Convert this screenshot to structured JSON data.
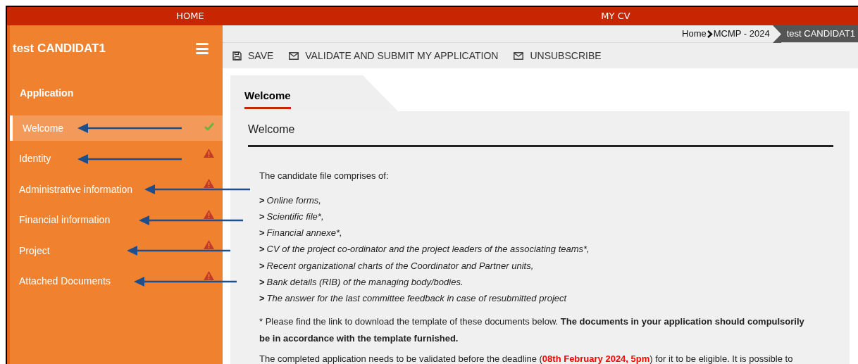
{
  "top_nav": [
    {
      "label": "HOME"
    },
    {
      "label": "MY CV"
    }
  ],
  "sidebar": {
    "user": "test CANDIDAT1",
    "section": "Application",
    "items": [
      {
        "label": "Welcome",
        "selected": true,
        "complete": true
      },
      {
        "label": "Identity",
        "selected": false,
        "complete": false
      },
      {
        "label": "Administrative information",
        "selected": false,
        "complete": false
      },
      {
        "label": "Financial information",
        "selected": false,
        "complete": false
      },
      {
        "label": "Project",
        "selected": false,
        "complete": false
      },
      {
        "label": "Attached Documents",
        "selected": false,
        "complete": false
      }
    ]
  },
  "breadcrumb": [
    "Home",
    "MCMP - 2024",
    "test CANDIDAT1"
  ],
  "toolbar": [
    {
      "label": "SAVE",
      "kind": "save"
    },
    {
      "label": "VALIDATE AND SUBMIT MY APPLICATION",
      "kind": "mail"
    },
    {
      "label": "UNSUBSCRIBE",
      "kind": "mail"
    }
  ],
  "tab": {
    "label": "Welcome",
    "selected": true
  },
  "panel": {
    "heading": "Welcome",
    "intro": "The candidate file comprises of:",
    "list": [
      "Online forms,",
      "Scientific file*,",
      "Financial annexe*,",
      "CV of the project co-ordinator and the project leaders of the associating teams*,",
      "Recent organizational charts of the Coordinator and Partner units,",
      "Bank details (RIB) of the managing body/bodies.",
      "The answer for the last committee feedback in case of resubmitted project"
    ],
    "list_marker": ">",
    "note": "* Please find the link to download the template of these documents below. **The documents in your application should compulsorily be in accordance with the template furnished.**",
    "deadline_sentence": {
      "before": "The completed application needs to be validated before the deadline (",
      "deadline": "08th February 2024, 5pm",
      "after": ") for it to be eligible. It is possible to"
    }
  }
}
